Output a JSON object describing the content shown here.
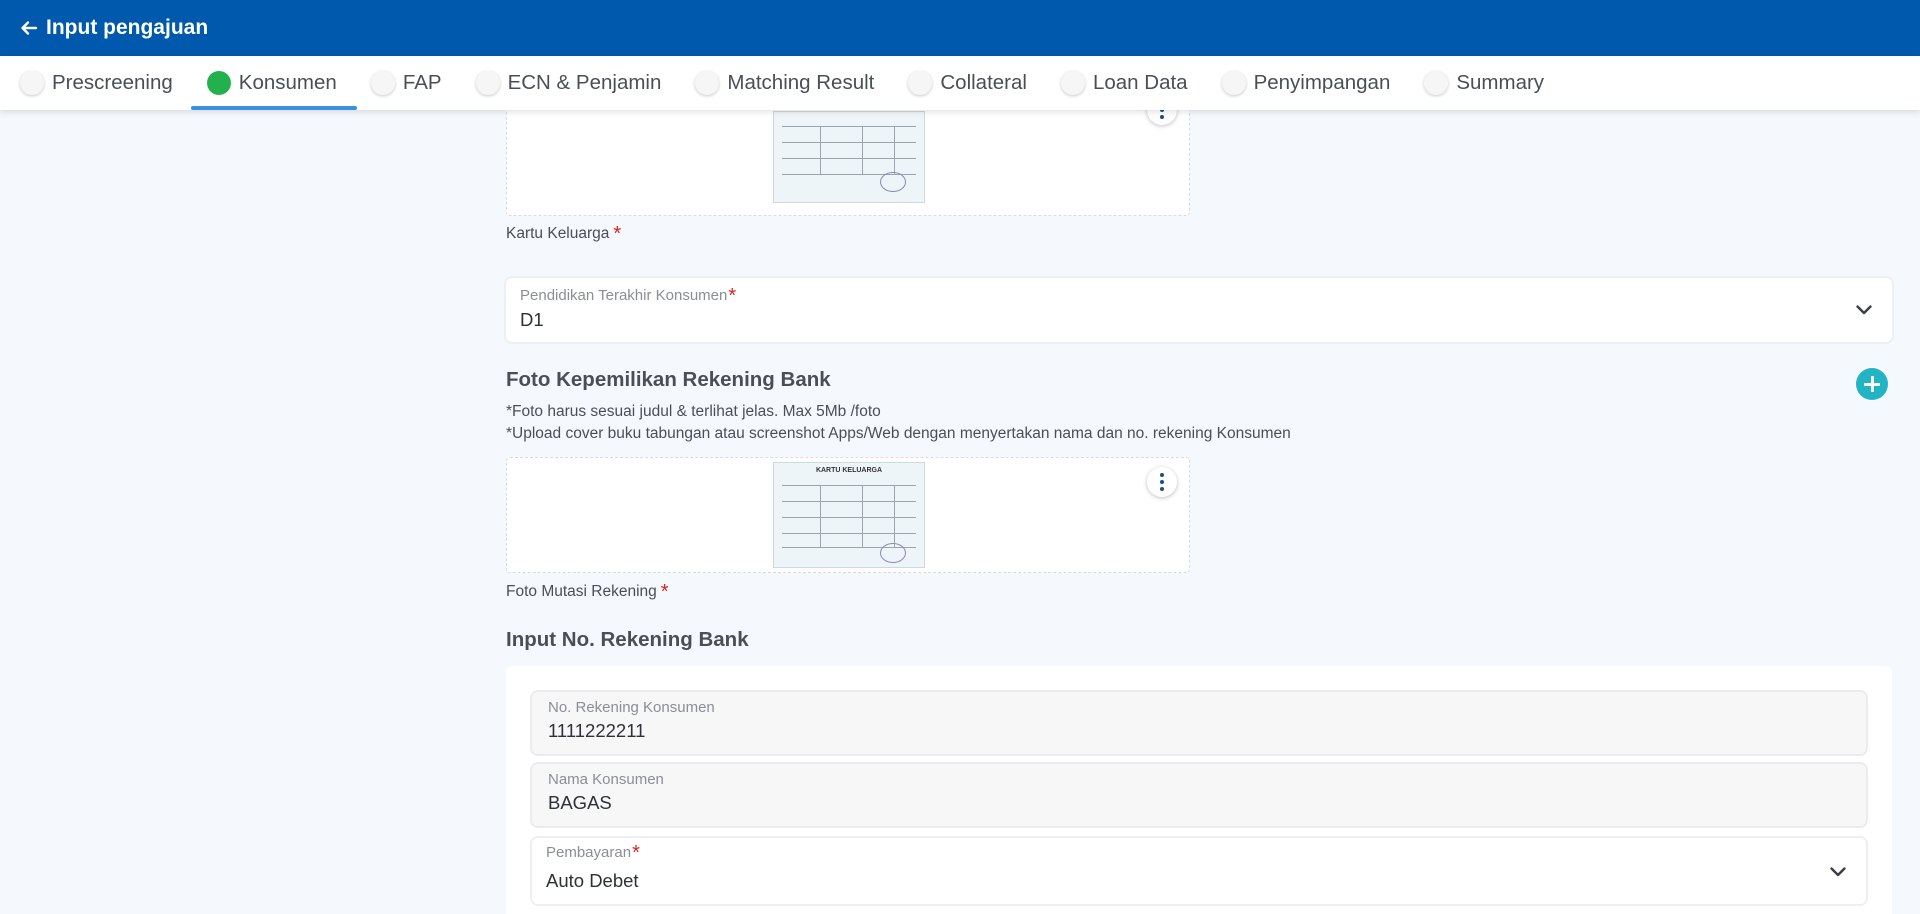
{
  "header": {
    "title": "Input pengajuan",
    "back_icon": "arrow-left-icon"
  },
  "tabs": [
    {
      "label": "Prescreening",
      "status": "inactive"
    },
    {
      "label": "Konsumen",
      "status": "active"
    },
    {
      "label": "FAP",
      "status": "inactive"
    },
    {
      "label": "ECN & Penjamin",
      "status": "inactive"
    },
    {
      "label": "Matching Result",
      "status": "inactive"
    },
    {
      "label": "Collateral",
      "status": "inactive"
    },
    {
      "label": "Loan Data",
      "status": "inactive"
    },
    {
      "label": "Penyimpangan",
      "status": "inactive"
    },
    {
      "label": "Summary",
      "status": "inactive"
    }
  ],
  "kk_section": {
    "caption": "Kartu Keluarga",
    "required_mark": "*"
  },
  "pendidikan": {
    "label": "Pendidikan Terakhir Konsumen",
    "required_mark": "*",
    "value": "D1"
  },
  "rekening_photo": {
    "title": "Foto Kepemilikan Rekening Bank",
    "notes": [
      "*Foto harus sesuai judul & terlihat jelas. Max 5Mb /foto",
      "*Upload cover buku tabungan atau screenshot Apps/Web dengan menyertakan nama dan no. rekening Konsumen"
    ],
    "caption": "Foto Mutasi Rekening",
    "required_mark": "*",
    "doc_title": "KARTU KELUARGA"
  },
  "bank_input": {
    "title": "Input No. Rekening Bank",
    "rekening": {
      "label": "No. Rekening Konsumen",
      "value": "1111222211"
    },
    "nama": {
      "label": "Nama Konsumen",
      "value": "BAGAS"
    },
    "pembayaran": {
      "label": "Pembayaran",
      "required_mark": "*",
      "value": "Auto Debet"
    }
  },
  "colors": {
    "primary": "#0059ac",
    "active_tab": "#22b14c",
    "tab_underline": "#3b8fe0",
    "add_button": "#22b4c4",
    "required": "#e02020"
  }
}
